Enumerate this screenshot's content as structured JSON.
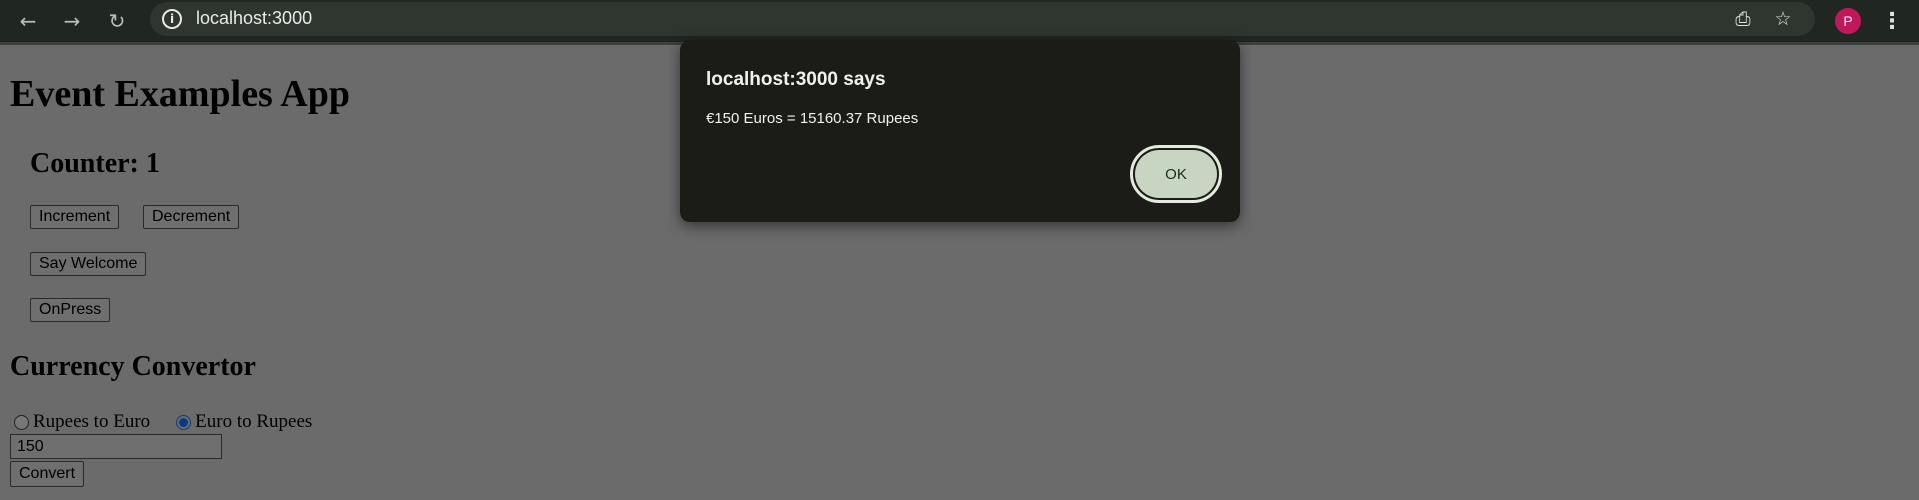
{
  "browser": {
    "url": "localhost:3000",
    "icons": {
      "back": "arrow-left-icon",
      "forward": "arrow-right-icon",
      "reload": "reload-icon",
      "info": "info-icon",
      "install": "install-app-icon",
      "bookmark": "star-icon",
      "menu": "more-vert-icon"
    },
    "profile_initial": "P",
    "profile_color": "#c2185b"
  },
  "page": {
    "title": "Event Examples App",
    "counter": {
      "heading": "Counter: 1",
      "increment_label": "Increment",
      "decrement_label": "Decrement",
      "welcome_label": "Say Welcome",
      "onpress_label": "OnPress"
    },
    "currency": {
      "heading": "Currency Convertor",
      "option_rupees_to_euro": "Rupees to Euro",
      "option_euro_to_rupees": "Euro to Rupees",
      "selected": "Euro to Rupees",
      "amount_value": "150",
      "convert_label": "Convert"
    }
  },
  "dialog": {
    "title": "localhost:3000 says",
    "message": "€150 Euros = 15160.37 Rupees",
    "ok_label": "OK",
    "accent": "#c7d5c2"
  }
}
